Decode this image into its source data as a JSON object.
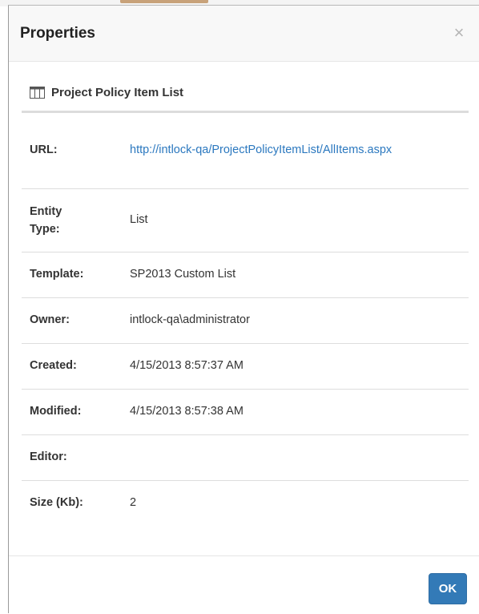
{
  "dialog": {
    "title": "Properties",
    "close_glyph": "×",
    "close_icon": "close-icon"
  },
  "list": {
    "icon": "table-icon",
    "name": "Project Policy Item List"
  },
  "properties": [
    {
      "label": "URL:",
      "value": "http://intlock-qa/ProjectPolicyItemList/AllItems.aspx",
      "is_link": true
    },
    {
      "label": "Entity Type:",
      "value": "List"
    },
    {
      "label": "Template:",
      "value": "SP2013 Custom List"
    },
    {
      "label": "Owner:",
      "value": "intlock-qa\\administrator"
    },
    {
      "label": "Created:",
      "value": "4/15/2013 8:57:37 AM"
    },
    {
      "label": "Modified:",
      "value": "4/15/2013 8:57:38 AM"
    },
    {
      "label": "Editor:",
      "value": ""
    },
    {
      "label": "Size (Kb):",
      "value": "2"
    }
  ],
  "footer": {
    "ok_label": "OK"
  },
  "colors": {
    "link": "#2b78bf",
    "primary_button": "#337ab7",
    "header_bg": "#f8f8f8"
  }
}
